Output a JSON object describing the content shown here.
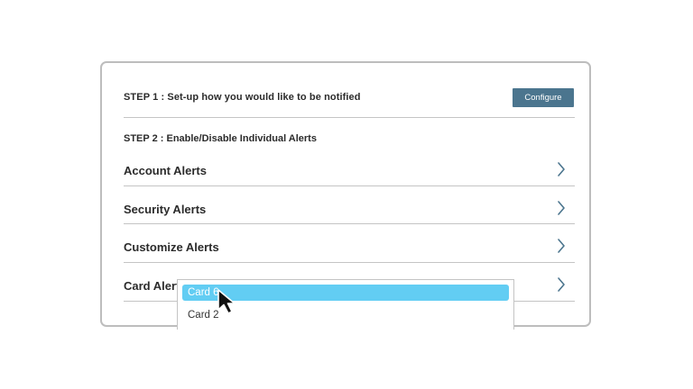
{
  "step1": {
    "text": "STEP 1 : Set-up how you would like to be notified",
    "configure_label": "Configure"
  },
  "step2": {
    "text": "STEP 2 : Enable/Disable Individual Alerts"
  },
  "alerts": [
    {
      "label": "Account Alerts",
      "icon": "chevron-right-icon"
    },
    {
      "label": "Security Alerts",
      "icon": "chevron-right-icon"
    },
    {
      "label": "Customize Alerts",
      "icon": "chevron-right-icon"
    },
    {
      "label": "Card Alerts",
      "icon": "chevron-right-icon"
    }
  ],
  "card_dropdown": {
    "options": [
      {
        "label": "Card 6",
        "selected": true
      },
      {
        "label": "Card 2",
        "selected": false
      }
    ]
  },
  "colors": {
    "configure_button": "#4b758e",
    "selected_option": "#62cdf3",
    "panel_border": "#bdbdbd",
    "divider": "#c4c4c4",
    "chevron": "#4b758e"
  },
  "icons": {
    "pointer": "mouse-pointer-icon"
  }
}
